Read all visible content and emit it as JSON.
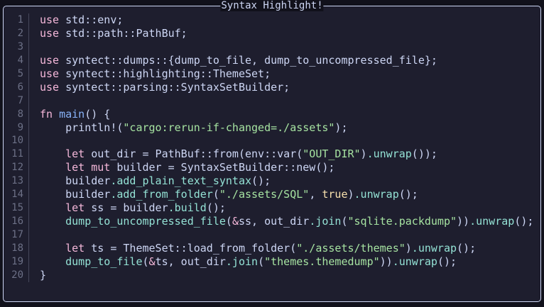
{
  "window": {
    "title": "Syntax Highlight!"
  },
  "colors": {
    "keyword": "#f5b8da",
    "function": "#89b4fa",
    "string": "#a6e3a1",
    "method": "#94e2d5",
    "boolean": "#f9e2af",
    "text": "#cdd6f4",
    "background": "#1e1e2e"
  },
  "lines": [
    {
      "n": "1",
      "tokens": [
        {
          "c": "k",
          "text": "use"
        },
        {
          "c": "p",
          "text": " std::env;"
        }
      ]
    },
    {
      "n": "2",
      "tokens": [
        {
          "c": "k",
          "text": "use"
        },
        {
          "c": "p",
          "text": " std::path::PathBuf;"
        }
      ]
    },
    {
      "n": "3",
      "tokens": []
    },
    {
      "n": "4",
      "tokens": [
        {
          "c": "k",
          "text": "use"
        },
        {
          "c": "p",
          "text": " syntect::dumps::{dump_to_file, dump_to_uncompressed_file};"
        }
      ]
    },
    {
      "n": "5",
      "tokens": [
        {
          "c": "k",
          "text": "use"
        },
        {
          "c": "p",
          "text": " syntect::highlighting::ThemeSet;"
        }
      ]
    },
    {
      "n": "6",
      "tokens": [
        {
          "c": "k",
          "text": "use"
        },
        {
          "c": "p",
          "text": " syntect::parsing::SyntaxSetBuilder;"
        }
      ]
    },
    {
      "n": "7",
      "tokens": []
    },
    {
      "n": "8",
      "tokens": [
        {
          "c": "k",
          "text": "fn"
        },
        {
          "c": "p",
          "text": " "
        },
        {
          "c": "f",
          "text": "main"
        },
        {
          "c": "p",
          "text": "() {"
        }
      ]
    },
    {
      "n": "9",
      "tokens": [
        {
          "c": "p",
          "text": "    println!("
        },
        {
          "c": "s",
          "text": "\"cargo:rerun-if-changed=./assets\""
        },
        {
          "c": "p",
          "text": ");"
        }
      ]
    },
    {
      "n": "10",
      "tokens": []
    },
    {
      "n": "11",
      "tokens": [
        {
          "c": "p",
          "text": "    "
        },
        {
          "c": "k",
          "text": "let"
        },
        {
          "c": "p",
          "text": " out_dir = PathBuf::from(env::var("
        },
        {
          "c": "s",
          "text": "\"OUT_DIR\""
        },
        {
          "c": "p",
          "text": ")"
        },
        {
          "c": "m",
          "text": ".unwrap"
        },
        {
          "c": "p",
          "text": "());"
        }
      ]
    },
    {
      "n": "12",
      "tokens": [
        {
          "c": "p",
          "text": "    "
        },
        {
          "c": "k",
          "text": "let"
        },
        {
          "c": "p",
          "text": " "
        },
        {
          "c": "k",
          "text": "mut"
        },
        {
          "c": "p",
          "text": " builder = SyntaxSetBuilder::new();"
        }
      ]
    },
    {
      "n": "13",
      "tokens": [
        {
          "c": "p",
          "text": "    builder"
        },
        {
          "c": "m",
          "text": ".add_plain_text_syntax"
        },
        {
          "c": "p",
          "text": "();"
        }
      ]
    },
    {
      "n": "14",
      "tokens": [
        {
          "c": "p",
          "text": "    builder"
        },
        {
          "c": "m",
          "text": ".add_from_folder"
        },
        {
          "c": "p",
          "text": "("
        },
        {
          "c": "s",
          "text": "\"./assets/SQL\""
        },
        {
          "c": "p",
          "text": ", "
        },
        {
          "c": "b",
          "text": "true"
        },
        {
          "c": "p",
          "text": ")"
        },
        {
          "c": "m",
          "text": ".unwrap"
        },
        {
          "c": "p",
          "text": "();"
        }
      ]
    },
    {
      "n": "15",
      "tokens": [
        {
          "c": "p",
          "text": "    "
        },
        {
          "c": "k",
          "text": "let"
        },
        {
          "c": "p",
          "text": " ss = builder"
        },
        {
          "c": "m",
          "text": ".build"
        },
        {
          "c": "p",
          "text": "();"
        }
      ]
    },
    {
      "n": "16",
      "tokens": [
        {
          "c": "p",
          "text": "    "
        },
        {
          "c": "m",
          "text": "dump_to_uncompressed_file"
        },
        {
          "c": "p",
          "text": "("
        },
        {
          "c": "k",
          "text": "&"
        },
        {
          "c": "p",
          "text": "ss, out_dir"
        },
        {
          "c": "m",
          "text": ".join"
        },
        {
          "c": "p",
          "text": "("
        },
        {
          "c": "s",
          "text": "\"sqlite.packdump\""
        },
        {
          "c": "p",
          "text": "))"
        },
        {
          "c": "m",
          "text": ".unwrap"
        },
        {
          "c": "p",
          "text": "();"
        }
      ]
    },
    {
      "n": "17",
      "tokens": []
    },
    {
      "n": "18",
      "tokens": [
        {
          "c": "p",
          "text": "    "
        },
        {
          "c": "k",
          "text": "let"
        },
        {
          "c": "p",
          "text": " ts = ThemeSet::load_from_folder("
        },
        {
          "c": "s",
          "text": "\"./assets/themes\""
        },
        {
          "c": "p",
          "text": ")"
        },
        {
          "c": "m",
          "text": ".unwrap"
        },
        {
          "c": "p",
          "text": "();"
        }
      ]
    },
    {
      "n": "19",
      "tokens": [
        {
          "c": "p",
          "text": "    "
        },
        {
          "c": "m",
          "text": "dump_to_file"
        },
        {
          "c": "p",
          "text": "("
        },
        {
          "c": "k",
          "text": "&"
        },
        {
          "c": "p",
          "text": "ts, out_dir"
        },
        {
          "c": "m",
          "text": ".join"
        },
        {
          "c": "p",
          "text": "("
        },
        {
          "c": "s",
          "text": "\"themes.themedump\""
        },
        {
          "c": "p",
          "text": "))"
        },
        {
          "c": "m",
          "text": ".unwrap"
        },
        {
          "c": "p",
          "text": "();"
        }
      ]
    },
    {
      "n": "20",
      "tokens": [
        {
          "c": "p",
          "text": "}"
        }
      ]
    }
  ]
}
